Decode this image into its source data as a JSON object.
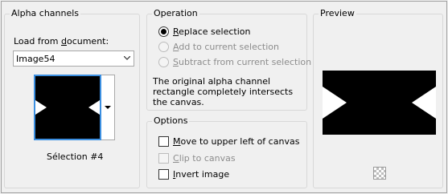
{
  "alpha_channels": {
    "title": "Alpha channels",
    "load_label_prefix": "Load from ",
    "load_label_underlined": "d",
    "load_label_suffix": "ocument:",
    "document_value": "Image54",
    "selection_caption": "Sélection #4"
  },
  "operation": {
    "title": "Operation",
    "options": [
      {
        "prefix": "",
        "underlined": "R",
        "rest": "eplace selection",
        "checked": true,
        "disabled": false
      },
      {
        "prefix": "",
        "underlined": "A",
        "rest": "dd to current selection",
        "checked": false,
        "disabled": true
      },
      {
        "prefix": "",
        "underlined": "S",
        "rest": "ubtract from current selection",
        "checked": false,
        "disabled": true
      }
    ],
    "description": "The original alpha channel rectangle completely intersects the canvas."
  },
  "options": {
    "title": "Options",
    "items": [
      {
        "prefix": "",
        "underlined": "M",
        "rest": "ove to upper left of canvas",
        "checked": false,
        "disabled": false
      },
      {
        "prefix": "",
        "underlined": "C",
        "rest": "lip to canvas",
        "checked": false,
        "disabled": true
      },
      {
        "prefix": "",
        "underlined": "I",
        "rest": "nvert image",
        "checked": false,
        "disabled": false
      }
    ]
  },
  "preview": {
    "title": "Preview",
    "background_icon": "checkerboard-icon"
  },
  "colors": {
    "thumbnail_border": "#3c8fe0",
    "shape_fill": "#000000",
    "cutout": "#ffffff"
  }
}
